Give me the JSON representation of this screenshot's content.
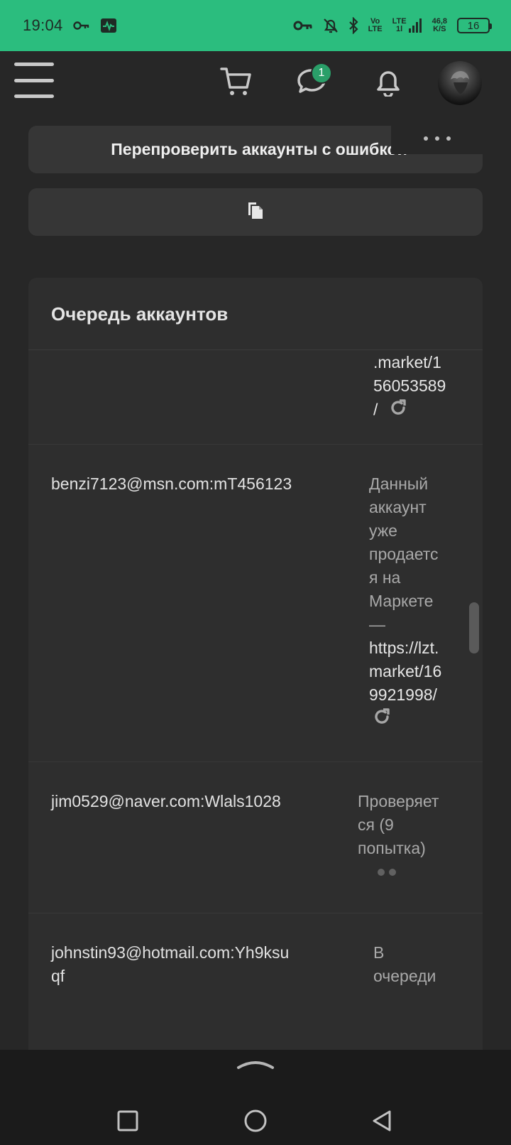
{
  "status_bar": {
    "time": "19:04",
    "network_top": "Vo",
    "network_bottom": "LTE",
    "lte2_top": "LTE",
    "lte2_bottom": "1l",
    "speed_value": "46,8",
    "speed_unit": "K/S",
    "battery": "16",
    "bg_color": "#2bbd7e"
  },
  "header": {
    "chat_badge": "1",
    "icons": [
      "menu-icon",
      "cart-icon",
      "chat-icon",
      "bell-icon",
      "avatar"
    ]
  },
  "actions": {
    "recheck_label": "Перепроверить аккаунты с ошибкой",
    "copy_icon": "copy-icon"
  },
  "queue": {
    "title": "Очередь аккаунтов",
    "rows": [
      {
        "account": "",
        "status_lines": [],
        "link_lines": [
          ".market/1",
          "56053589",
          "/"
        ],
        "has_reload": true
      },
      {
        "account": "benzi7123@msn.com:mT456123",
        "status_lines": [
          "Данный",
          "аккаунт",
          "уже",
          "продаетс",
          "я на",
          "Маркете",
          "—"
        ],
        "link_lines": [
          "https://lzt.",
          "market/16",
          "9921998/"
        ],
        "has_reload": true
      },
      {
        "account": "jim0529@naver.com:Wlals1028",
        "status_lines": [
          "Проверяет",
          "ся (9",
          "попытка)"
        ],
        "link_lines": [],
        "has_reload": false
      },
      {
        "account_lines": [
          "johnstin93@hotmail.com:Yh9ksu",
          "qf"
        ],
        "status_lines": [
          "В",
          "очереди"
        ],
        "link_lines": [],
        "has_reload": false
      }
    ]
  },
  "colors": {
    "background": "#272727",
    "card": "#2e2e2e",
    "accent_green": "#2a9f69"
  }
}
